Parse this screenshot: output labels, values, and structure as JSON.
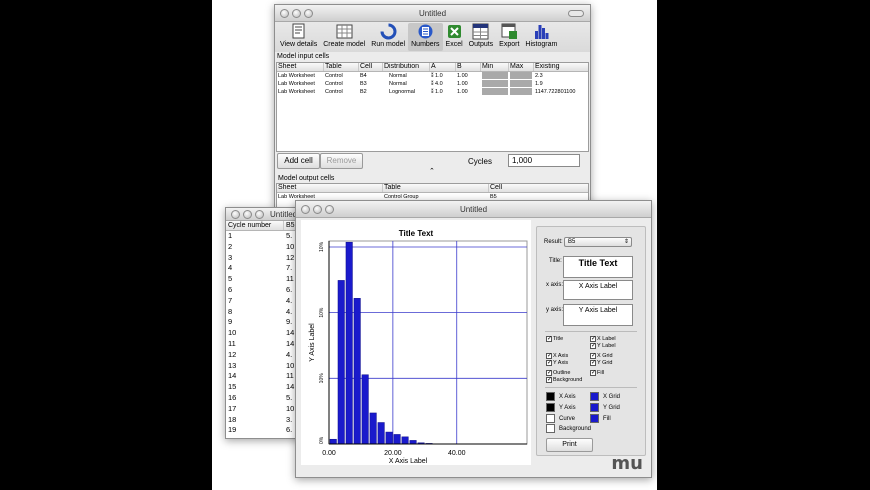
{
  "main_window": {
    "title": "Untitled",
    "toolbar": [
      {
        "id": "view-details",
        "label": "View details",
        "icon": "view-details-icon"
      },
      {
        "id": "create-model",
        "label": "Create model",
        "icon": "create-model-icon"
      },
      {
        "id": "run-model",
        "label": "Run model",
        "icon": "run-model-icon"
      },
      {
        "id": "numbers",
        "label": "Numbers",
        "icon": "numbers-icon",
        "selected": true
      },
      {
        "id": "excel",
        "label": "Excel",
        "icon": "excel-icon"
      },
      {
        "id": "outputs",
        "label": "Outputs",
        "icon": "outputs-icon"
      },
      {
        "id": "export",
        "label": "Export",
        "icon": "export-icon"
      },
      {
        "id": "histogram",
        "label": "Histogram",
        "icon": "histogram-icon"
      }
    ],
    "input_section_label": "Model input cells",
    "input_columns": [
      "Sheet",
      "Table",
      "Cell",
      "Distribution",
      "A",
      "B",
      "Min",
      "Max",
      "Existing"
    ],
    "input_rows": [
      {
        "sheet": "Lab Worksheet",
        "table": "Control",
        "cell": "B4",
        "distribution": "Normal",
        "a": "1.0",
        "b": "1.00",
        "existing": "2.3"
      },
      {
        "sheet": "Lab Worksheet",
        "table": "Control",
        "cell": "B3",
        "distribution": "Normal",
        "a": "4.0",
        "b": "1.00",
        "existing": "1.9"
      },
      {
        "sheet": "Lab Worksheet",
        "table": "Control",
        "cell": "B2",
        "distribution": "Lognormal",
        "a": "1.0",
        "b": "1.00",
        "existing": "1147.722801100"
      }
    ],
    "add_cell_label": "Add cell",
    "remove_label": "Remove",
    "cycles_label": "Cycles",
    "cycles_value": "1,000",
    "output_section_label": "Model output cells",
    "output_columns": [
      "Sheet",
      "Table",
      "Cell"
    ],
    "output_rows": [
      {
        "sheet": "Lab Worksheet",
        "table": "Control Group",
        "cell": "B5"
      }
    ]
  },
  "cycle_window": {
    "title": "Untitled",
    "columns": [
      "Cycle number",
      "B5"
    ],
    "rows": [
      {
        "n": "1",
        "v": "5."
      },
      {
        "n": "2",
        "v": "10"
      },
      {
        "n": "3",
        "v": "12"
      },
      {
        "n": "4",
        "v": "7."
      },
      {
        "n": "5",
        "v": "11"
      },
      {
        "n": "6",
        "v": "6."
      },
      {
        "n": "7",
        "v": "4."
      },
      {
        "n": "8",
        "v": "4."
      },
      {
        "n": "9",
        "v": "9."
      },
      {
        "n": "10",
        "v": "14"
      },
      {
        "n": "11",
        "v": "14"
      },
      {
        "n": "12",
        "v": "4."
      },
      {
        "n": "13",
        "v": "10"
      },
      {
        "n": "14",
        "v": "11"
      },
      {
        "n": "15",
        "v": "14"
      },
      {
        "n": "16",
        "v": "5."
      },
      {
        "n": "17",
        "v": "10"
      },
      {
        "n": "18",
        "v": "3."
      },
      {
        "n": "19",
        "v": "6."
      }
    ]
  },
  "histogram_window": {
    "title": "Untitled",
    "result_label": "Result:",
    "result_value": "B5",
    "title_field_label": "Title:",
    "title_field_value": "Title Text",
    "xaxis_field_label": "x axis:",
    "xaxis_field_value": "X Axis Label",
    "yaxis_field_label": "y axis:",
    "yaxis_field_value": "Y Axis Label",
    "checkboxes": [
      {
        "label": "Title",
        "checked": true
      },
      {
        "label": "X Label",
        "checked": true
      },
      {
        "label": "Y Label",
        "checked": true
      },
      {
        "label": "X Axis",
        "checked": true
      },
      {
        "label": "X Grid",
        "checked": true
      },
      {
        "label": "Y Axis",
        "checked": true
      },
      {
        "label": "Y Grid",
        "checked": true
      },
      {
        "label": "Outline",
        "checked": true
      },
      {
        "label": "Fill",
        "checked": true
      },
      {
        "label": "Background",
        "checked": true
      }
    ],
    "colors": [
      {
        "label": "X Axis",
        "color": "#000000"
      },
      {
        "label": "X Grid",
        "color": "#1a1acc"
      },
      {
        "label": "Y Axis",
        "color": "#000000"
      },
      {
        "label": "Y Grid",
        "color": "#1a1acc"
      },
      {
        "label": "Curve",
        "color": "#ffffff"
      },
      {
        "label": "Fill",
        "color": "#1a1acc"
      },
      {
        "label": "Background",
        "color": "#ffffff"
      }
    ],
    "print_label": "Print",
    "logo_text": "mu"
  },
  "chart_data": {
    "type": "bar",
    "title": "Title Text",
    "xlabel": "X Axis Label",
    "ylabel": "Y Axis Label",
    "x_ticks": [
      "0.00",
      "20.00",
      "40.00"
    ],
    "y_ticks": [
      "0%",
      "10%",
      "10%",
      "10%"
    ],
    "xlim": [
      0,
      62
    ],
    "ylim": [
      0,
      17
    ],
    "bin_width": 2.5,
    "bins_start": 0,
    "values": [
      0.4,
      13.7,
      16.9,
      12.2,
      5.8,
      2.6,
      1.8,
      1.0,
      0.8,
      0.6,
      0.3,
      0.1,
      0.05
    ],
    "grid": true,
    "bar_color": "#1a1acc"
  }
}
